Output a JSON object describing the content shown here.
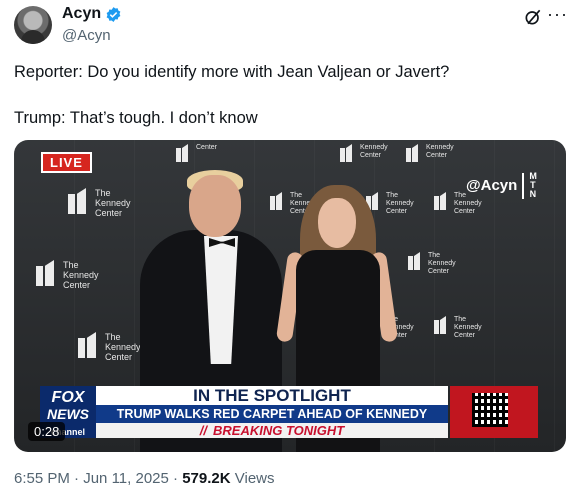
{
  "author": {
    "name": "Acyn",
    "handle": "@Acyn"
  },
  "tweet": {
    "line1": "Reporter: Do you identify more with Jean Valjean or Javert?",
    "line2": "Trump: That’s tough. I don’t know"
  },
  "video": {
    "live_badge": "LIVE",
    "watermark_handle": "@Acyn",
    "watermark_tag": "MTN",
    "backdrop_logo": {
      "line1": "The",
      "line2": "Kennedy",
      "line3": "Center"
    },
    "chyron": {
      "network_line1": "FOX",
      "network_line2": "NEWS",
      "network_line3": "channel",
      "headline": "IN THE SPOTLIGHT",
      "subhead": "TRUMP WALKS RED CARPET AHEAD OF KENNEDY CENTER MUSICAL",
      "banner": "BREAKING TONIGHT"
    },
    "duration": "0:28"
  },
  "meta": {
    "time": "6:55 PM",
    "separator": "·",
    "date": "Jun 11, 2025",
    "views_count": "579.2K",
    "views_label": "Views"
  },
  "icons": [
    "verified-badge-icon",
    "grok-icon",
    "more-icon"
  ],
  "colors": {
    "verified": "#1d9bf0",
    "live": "#d6261f",
    "fox_blue": "#0b2a6b",
    "breaking_red": "#c8102e"
  }
}
